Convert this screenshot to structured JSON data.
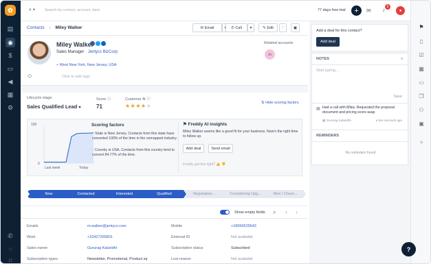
{
  "topbar": {
    "search_placeholder": "Search by contact, account, deal",
    "trial": "77 days free trial",
    "notif_count": "5",
    "avatar_initial": "G"
  },
  "header": {
    "breadcrumb_root": "Contacts",
    "breadcrumb_current": "Miley Walker",
    "email_btn": "Email",
    "call_btn": "Call",
    "edit_btn": "Edit"
  },
  "profile": {
    "name": "Miley Walker",
    "title": "Sales Manager",
    "company": "Jentycs BizCorp",
    "location": "West New York, New Jersey, USA",
    "add_tags": "Click to add tags",
    "related_label": "Related accounts",
    "related_initials": "Je"
  },
  "metrics": {
    "lifecycle_label": "Lifecycle stage",
    "lifecycle_value": "Sales Qualified Lead",
    "score_label": "Score",
    "score_value": "71",
    "fit_label": "Customer fit",
    "fit_rating": 4,
    "hide_link": "Hide scoring factors"
  },
  "scoring": {
    "y_top": "100",
    "y_bottom": "0",
    "x_left": "Last week",
    "x_right": "Today",
    "title": "Scoring factors",
    "factor1": "State is New Jersey. Contacts from this state have converted 100% of the time in the unmapped industry.",
    "factor2": "Country is USA. Contacts from this country tend to convert 84.77% of the time.",
    "trend": [
      3,
      3,
      3,
      3,
      3,
      72,
      80,
      81,
      81,
      82
    ]
  },
  "freddy": {
    "title": "Freddy AI insights",
    "text": "Miley Walker seems like a good fit for your business. Now's the right time to follow up.",
    "add_deal": "Add deal",
    "send_email": "Send email",
    "feedback": "Freddy got this right?"
  },
  "stages": [
    "New",
    "Contacted",
    "Interested",
    "Qualified",
    "Negotiation ...",
    "Considering Upg...",
    "Won / Churn..."
  ],
  "fields": {
    "show_empty": "Show empty fields",
    "rows": [
      {
        "l1": "Emails",
        "v1": "m.walker@jentycs.com",
        "l2": "Mobile",
        "v2": "+18056529543"
      },
      {
        "l1": "Work",
        "v1": "+10427265801",
        "l2": "External ID",
        "v2": "Not available"
      },
      {
        "l1": "Sales owner",
        "v1": "Gururag Kalaridhi",
        "l2": "Subscription status",
        "v2": "Subscribed"
      },
      {
        "l1": "Subscription types",
        "v1": "Newsletter, Promotional, Product sq",
        "l2": "Lost reason",
        "v2": "Not available"
      }
    ]
  },
  "right": {
    "deal_prompt": "Add a deal for this contact?",
    "add_deal": "Add deal",
    "notes_title": "NOTES",
    "notes_placeholder": "Start typing...",
    "save": "Save",
    "note_text": "Had a call with Miley. Requested the proposal document and pricing score asap",
    "note_author": "Gururag Kalaridhi",
    "note_time": "a few seconds ago",
    "reminders_title": "REMINDERS",
    "no_reminders": "No reminders found"
  },
  "help": "?"
}
